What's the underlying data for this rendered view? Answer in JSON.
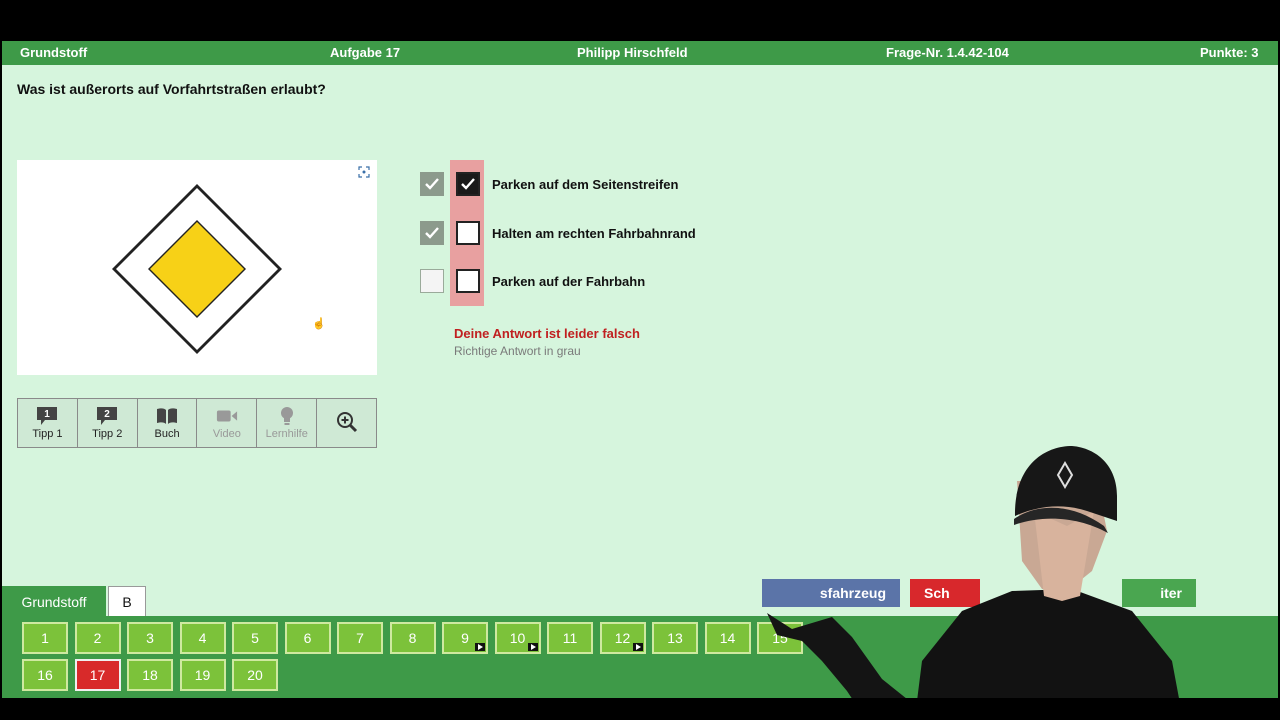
{
  "header": {
    "category": "Grundstoff",
    "task": "Aufgabe 17",
    "user": "Philipp Hirschfeld",
    "question_no": "Frage-Nr. 1.4.42-104",
    "points": "Punkte: 3"
  },
  "question": "Was ist außerorts auf Vorfahrtstraßen erlaubt?",
  "image": {
    "icon": "priority-road-sign",
    "expand_icon": "expand-icon"
  },
  "toolbar": [
    {
      "label": "Tipp 1",
      "icon": "tip-1-icon",
      "enabled": true
    },
    {
      "label": "Tipp 2",
      "icon": "tip-2-icon",
      "enabled": true
    },
    {
      "label": "Buch",
      "icon": "book-icon",
      "enabled": true
    },
    {
      "label": "Video",
      "icon": "video-icon",
      "enabled": false
    },
    {
      "label": "Lernhilfe",
      "icon": "lightbulb-icon",
      "enabled": false
    },
    {
      "label": "",
      "icon": "zoom-in-icon",
      "enabled": true
    }
  ],
  "answers": [
    {
      "text": "Parken auf dem Seitenstreifen",
      "correct": true,
      "user_checked": true
    },
    {
      "text": "Halten am rechten Fahrbahnrand",
      "correct": true,
      "user_checked": false
    },
    {
      "text": "Parken auf der Fahrbahn",
      "correct": false,
      "user_checked": false
    }
  ],
  "feedback": {
    "wrong": "Deine Antwort ist leider falsch",
    "hint": "Richtige Antwort in grau"
  },
  "actions": {
    "vehicle_visible": "sfahrzeug",
    "close_visible": "Sch",
    "next_visible": "iter"
  },
  "tabs": {
    "active": "Grundstoff",
    "inactive": "B"
  },
  "question_grid": {
    "row1": [
      "1",
      "2",
      "3",
      "4",
      "5",
      "6",
      "7",
      "8",
      "9",
      "10",
      "11",
      "12",
      "13",
      "14",
      "15"
    ],
    "row2": [
      "16",
      "17",
      "18",
      "19",
      "20"
    ],
    "current": "17",
    "video_marked": [
      "9",
      "10",
      "12"
    ]
  },
  "colors": {
    "header_green": "#3e9a48",
    "background": "#d6f5dd",
    "question_button": "#7cc23a",
    "current_button": "#d82a2a",
    "wrong_text": "#c02020",
    "user_column": "#e8a0a0"
  }
}
